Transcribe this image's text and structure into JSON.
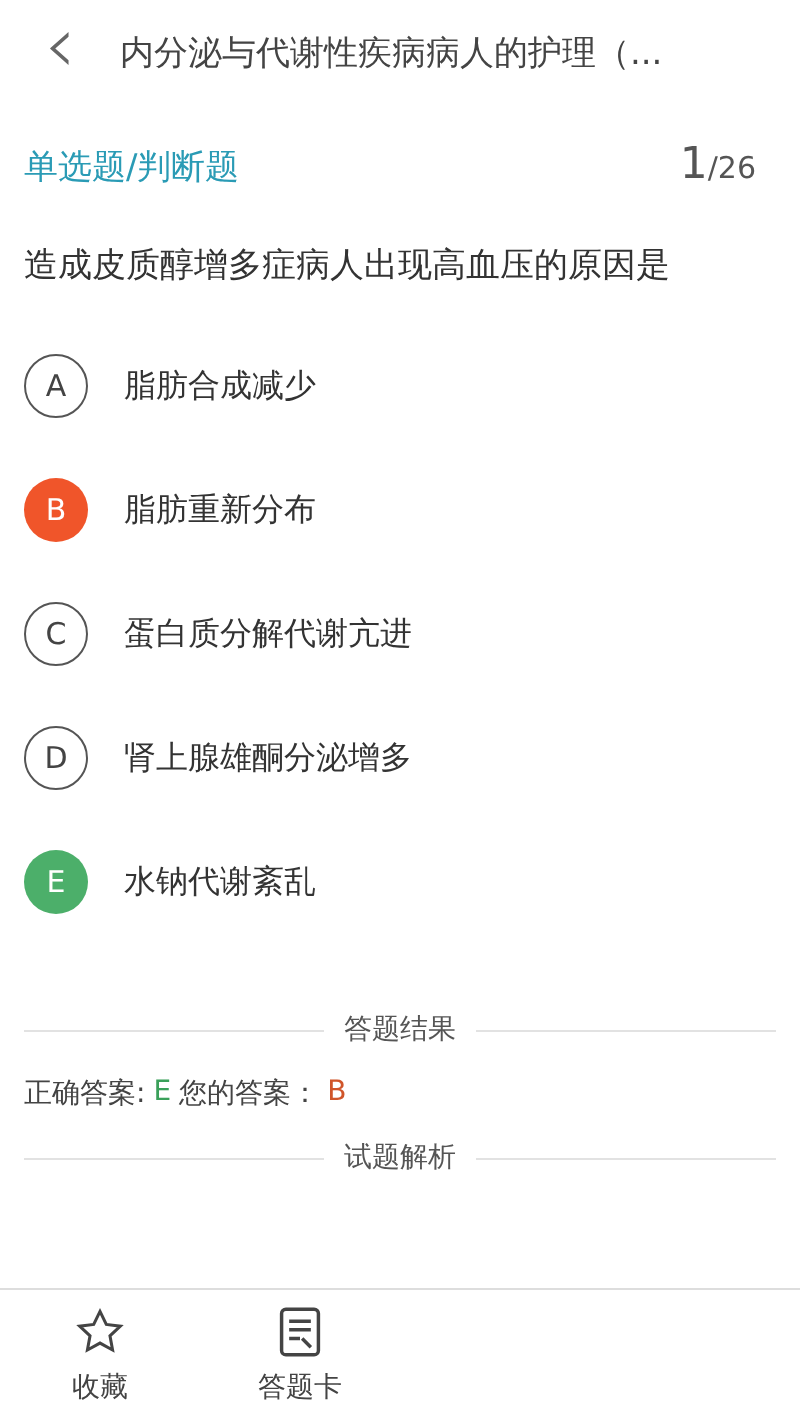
{
  "header": {
    "back": "‹",
    "title": "内分泌与代谢性疾病病人的护理（..."
  },
  "question": {
    "type_label": "单选题/判断题",
    "index": "1",
    "total": "/26",
    "stem": "造成皮质醇增多症病人出现高血压的原因是"
  },
  "options": [
    {
      "letter": "A",
      "text": "脂肪合成减少",
      "selected": false,
      "correct": false
    },
    {
      "letter": "B",
      "text": "脂肪重新分布",
      "selected": true,
      "correct": false
    },
    {
      "letter": "C",
      "text": "蛋白质分解代谢亢进",
      "selected": false,
      "correct": false
    },
    {
      "letter": "D",
      "text": "肾上腺雄酮分泌增多",
      "selected": false,
      "correct": false
    },
    {
      "letter": "E",
      "text": "水钠代谢紊乱",
      "selected": false,
      "correct": true
    }
  ],
  "result": {
    "heading": "答题结果",
    "correct_label": "正确答案:",
    "correct_value": "E",
    "your_label": "您的答案：",
    "your_value": "B"
  },
  "analysis": {
    "heading": "试题解析"
  },
  "tab_bar": [
    {
      "kind": "star",
      "label": "收藏"
    },
    {
      "kind": "card",
      "label": "答题卡"
    }
  ]
}
